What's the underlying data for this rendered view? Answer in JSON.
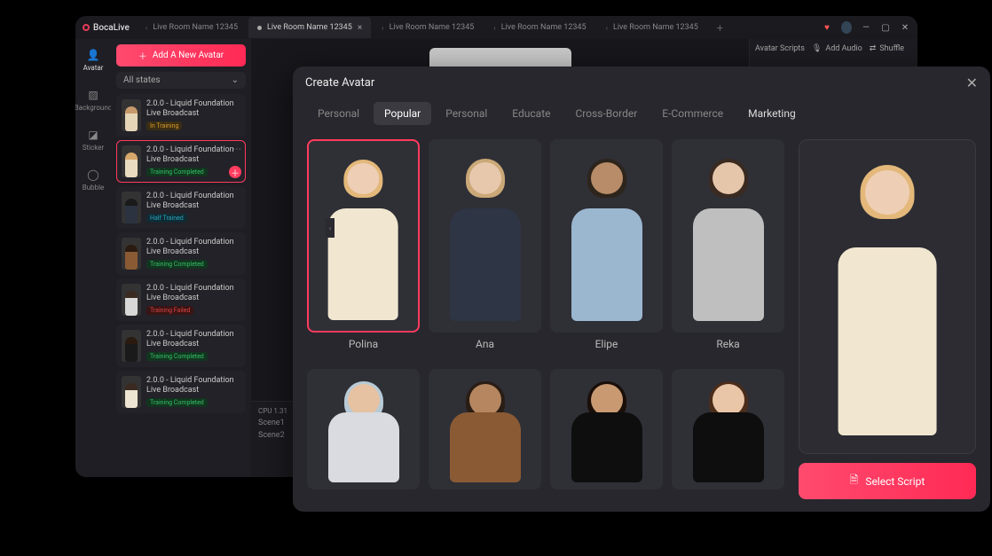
{
  "app": {
    "name": "BocaLive"
  },
  "tabs": {
    "items": [
      {
        "label": "Live Room Name 12345",
        "active": false
      },
      {
        "label": "Live Room Name 12345",
        "active": true
      },
      {
        "label": "Live Room Name 12345",
        "active": false
      },
      {
        "label": "Live Room Name 12345",
        "active": false
      },
      {
        "label": "Live Room Name 12345",
        "active": false
      }
    ]
  },
  "sidenav": {
    "items": [
      {
        "label": "Avatar"
      },
      {
        "label": "Background"
      },
      {
        "label": "Sticker"
      },
      {
        "label": "Bubble"
      }
    ]
  },
  "listpane": {
    "add_label": "Add A New Avatar",
    "filter_label": "All states",
    "items": [
      {
        "title": "2.0.0 - Liquid Foundation Live Broadcast",
        "status": "In Training",
        "status_kind": "train",
        "thumb": {
          "torso": "#e5d6b8",
          "hair": "#c69a6b"
        }
      },
      {
        "title": "2.0.0 - Liquid Foundation Live Broadcast",
        "status": "Training Completed",
        "status_kind": "done",
        "selected": true,
        "thumb": {
          "torso": "#e9dcc0",
          "hair": "#d6a86a"
        }
      },
      {
        "title": "2.0.0 - Liquid Foundation Live Broadcast",
        "status": "Half Trained",
        "status_kind": "half",
        "thumb": {
          "torso": "#2b3340",
          "hair": "#1a1a1a"
        }
      },
      {
        "title": "2.0.0 - Liquid Foundation Live Broadcast",
        "status": "Training Completed",
        "status_kind": "done",
        "thumb": {
          "torso": "#8a5a34",
          "hair": "#2a1a10"
        }
      },
      {
        "title": "2.0.0 - Liquid Foundation Live Broadcast",
        "status": "Training Failed",
        "status_kind": "fail",
        "thumb": {
          "torso": "#d8d8d8",
          "hair": "#3a2a20"
        }
      },
      {
        "title": "2.0.0 - Liquid Foundation Live Broadcast",
        "status": "Training Completed",
        "status_kind": "done",
        "thumb": {
          "torso": "#1a1a1a",
          "hair": "#2a1a10"
        }
      },
      {
        "title": "2.0.0 - Liquid Foundation Live Broadcast",
        "status": "Training Completed",
        "status_kind": "done",
        "thumb": {
          "torso": "#ede4d2",
          "hair": "#3a2a20"
        }
      }
    ]
  },
  "bottombar": {
    "cpu": "CPU  1.31",
    "scenes": [
      "Scene1",
      "Scene2"
    ]
  },
  "rightpane": {
    "scripts_label": "Avatar Scripts",
    "addaudio_label": "Add Audio",
    "shuffle_label": "Shuffle"
  },
  "modal": {
    "title": "Create Avatar",
    "tabs": [
      "Personal",
      "Popular",
      "Personal",
      "Educate",
      "Cross-Border",
      "E-Commerce",
      "Marketing"
    ],
    "active_tab": 1,
    "highlight_tab": 6,
    "select_label": "Select Script",
    "avatars_row1": [
      {
        "name": "Polina",
        "selected": true,
        "torso": "#f1e6d0",
        "hair": "#e3b87a",
        "skin": "#eecfb5"
      },
      {
        "name": "Ana",
        "torso": "#2e3544",
        "hair": "#caa877",
        "skin": "#e8c8ac"
      },
      {
        "name": "Elipe",
        "torso": "#9bb7cf",
        "hair": "#2d241c",
        "skin": "#b88c68"
      },
      {
        "name": "Reka",
        "torso": "#bfbfbf",
        "hair": "#3a2a20",
        "skin": "#e6c6aa"
      }
    ],
    "avatars_row2": [
      {
        "torso": "#d9dbe0",
        "hair": "#b7cad6",
        "skin": "#e6c2a2"
      },
      {
        "torso": "#8a5a34",
        "hair": "#2a1d14",
        "skin": "#b58660"
      },
      {
        "torso": "#0e0e0e",
        "hair": "#1a0e08",
        "skin": "#c99a72"
      },
      {
        "torso": "#0e0e0e",
        "hair": "#4a2d1a",
        "skin": "#eac6a8"
      }
    ],
    "preview": {
      "torso": "#f1e6d0",
      "hair": "#e3b87a",
      "skin": "#eecfb5"
    }
  }
}
